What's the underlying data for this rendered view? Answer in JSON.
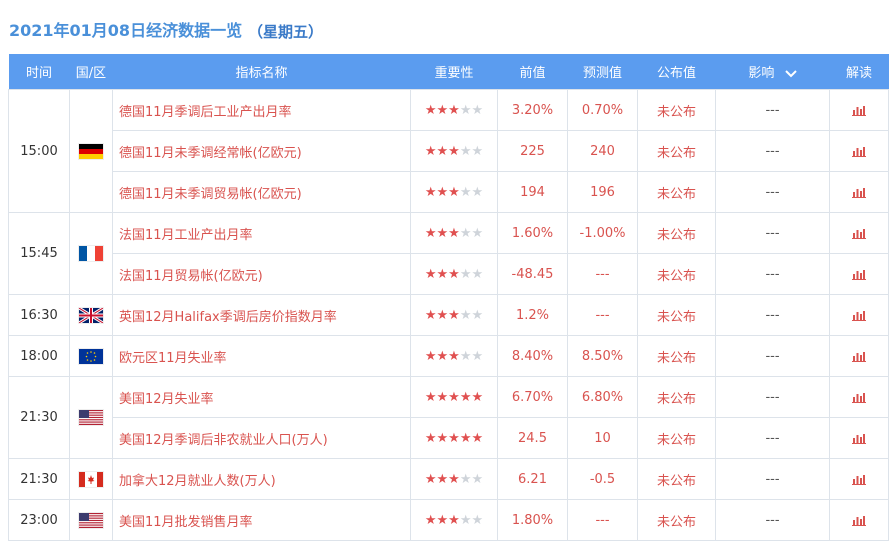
{
  "header": {
    "date_title": "2021年01月08日经济数据一览",
    "weekday": "（星期五）"
  },
  "columns": {
    "time": "时间",
    "country": "国/区",
    "indicator": "指标名称",
    "importance": "重要性",
    "previous": "前值",
    "forecast": "预测值",
    "actual": "公布值",
    "impact": "影响",
    "analysis": "解读"
  },
  "groups": [
    {
      "time": "15:00",
      "flag": "germany-flag",
      "rows": [
        {
          "name": "德国11月季调后工业产出月率",
          "stars": 3,
          "previous": "3.20%",
          "forecast": "0.70%",
          "actual": "未公布",
          "impact": "---"
        },
        {
          "name": "德国11月未季调经常帐(亿欧元)",
          "stars": 3,
          "previous": "225",
          "forecast": "240",
          "actual": "未公布",
          "impact": "---"
        },
        {
          "name": "德国11月未季调贸易帐(亿欧元)",
          "stars": 3,
          "previous": "194",
          "forecast": "196",
          "actual": "未公布",
          "impact": "---"
        }
      ]
    },
    {
      "time": "15:45",
      "flag": "france-flag",
      "rows": [
        {
          "name": "法国11月工业产出月率",
          "stars": 3,
          "previous": "1.60%",
          "forecast": "-1.00%",
          "actual": "未公布",
          "impact": "---"
        },
        {
          "name": "法国11月贸易帐(亿欧元)",
          "stars": 3,
          "previous": "-48.45",
          "forecast": "---",
          "actual": "未公布",
          "impact": "---"
        }
      ]
    },
    {
      "time": "16:30",
      "flag": "uk-flag",
      "rows": [
        {
          "name": "英国12月Halifax季调后房价指数月率",
          "stars": 3,
          "previous": "1.2%",
          "forecast": "---",
          "actual": "未公布",
          "impact": "---"
        }
      ]
    },
    {
      "time": "18:00",
      "flag": "eu-flag",
      "rows": [
        {
          "name": "欧元区11月失业率",
          "stars": 3,
          "previous": "8.40%",
          "forecast": "8.50%",
          "actual": "未公布",
          "impact": "---"
        }
      ]
    },
    {
      "time": "21:30",
      "flag": "usa-flag",
      "rows": [
        {
          "name": "美国12月失业率",
          "stars": 5,
          "previous": "6.70%",
          "forecast": "6.80%",
          "actual": "未公布",
          "impact": "---"
        },
        {
          "name": "美国12月季调后非农就业人口(万人)",
          "stars": 5,
          "previous": "24.5",
          "forecast": "10",
          "actual": "未公布",
          "impact": "---"
        }
      ]
    },
    {
      "time": "21:30",
      "flag": "canada-flag",
      "rows": [
        {
          "name": "加拿大12月就业人数(万人)",
          "stars": 3,
          "previous": "6.21",
          "forecast": "-0.5",
          "actual": "未公布",
          "impact": "---"
        }
      ]
    },
    {
      "time": "23:00",
      "flag": "usa-flag",
      "rows": [
        {
          "name": "美国11月批发销售月率",
          "stars": 3,
          "previous": "1.80%",
          "forecast": "---",
          "actual": "未公布",
          "impact": "---"
        }
      ]
    }
  ],
  "colors": {
    "header_bg": "#5b9cef",
    "accent_red": "#d9534f",
    "title_blue": "#4a90d9"
  }
}
